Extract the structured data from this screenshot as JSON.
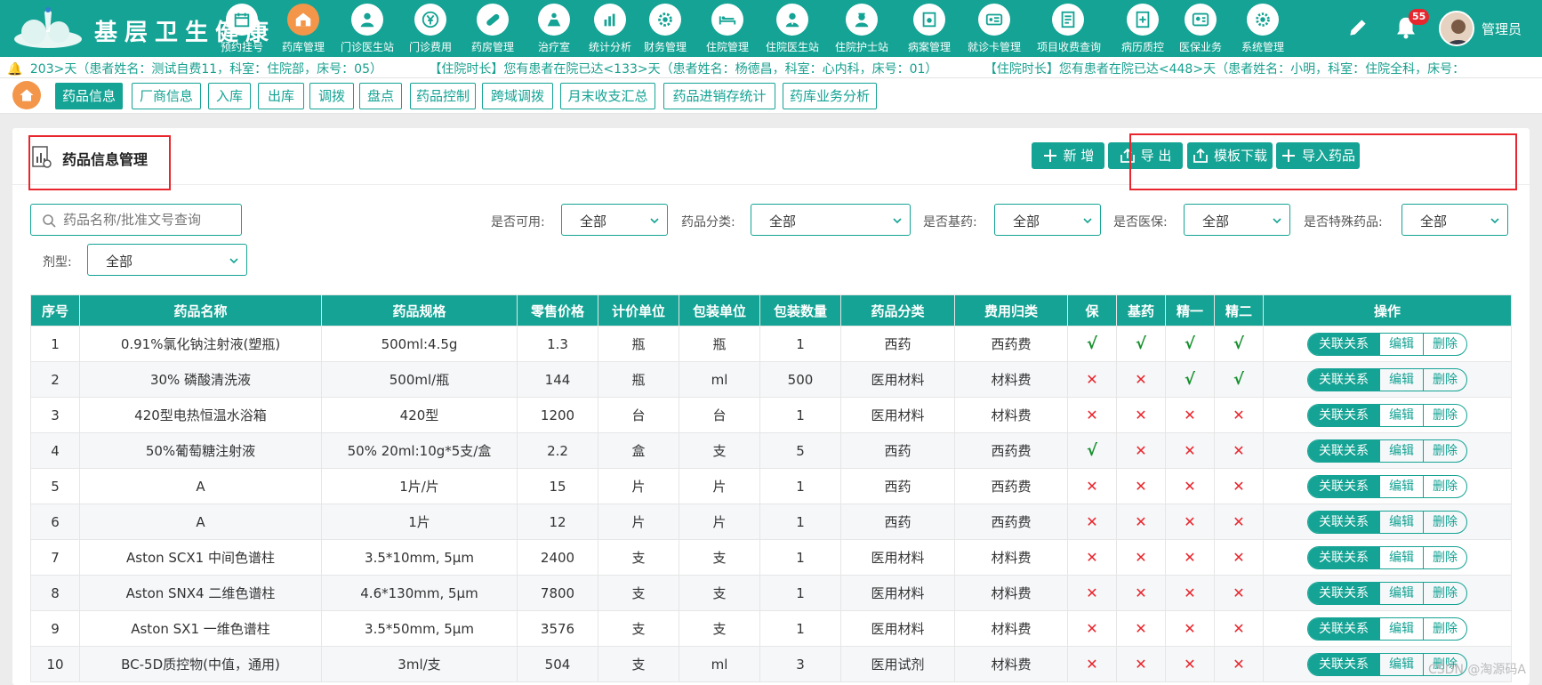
{
  "app": {
    "title": "基层卫生健康",
    "notification_count": "55",
    "user": "管理员"
  },
  "nav": [
    {
      "label": "预约挂号",
      "icon": "calendar-icon"
    },
    {
      "label": "药库管理",
      "icon": "warehouse-icon"
    },
    {
      "label": "门诊医生站",
      "icon": "doctor-icon"
    },
    {
      "label": "门诊费用",
      "icon": "yen-icon"
    },
    {
      "label": "药房管理",
      "icon": "pill-icon"
    },
    {
      "label": "治疗室",
      "icon": "therapy-icon"
    },
    {
      "label": "统计分析",
      "icon": "chart-icon"
    },
    {
      "label": "财务管理",
      "icon": "finance-gear-icon"
    },
    {
      "label": "住院管理",
      "icon": "hospital-bed-icon"
    },
    {
      "label": "住院医生站",
      "icon": "inpatient-doctor-icon"
    },
    {
      "label": "住院护士站",
      "icon": "nurse-station-icon"
    },
    {
      "label": "病案管理",
      "icon": "record-box-icon"
    },
    {
      "label": "就诊卡管理",
      "icon": "id-card-icon"
    },
    {
      "label": "项目收费查询",
      "icon": "fee-query-icon"
    },
    {
      "label": "病历质控",
      "icon": "medical-record-icon"
    },
    {
      "label": "医保业务",
      "icon": "insurance-icon"
    },
    {
      "label": "系统管理",
      "icon": "settings-icon"
    }
  ],
  "marquee": [
    "203>天（患者姓名：测试自费11，科室：住院部，床号：05）",
    "【住院时长】您有患者在院已达<133>天（患者姓名：杨德昌，科室：心内科，床号：01）",
    "【住院时长】您有患者在院已达<448>天（患者姓名：小明，科室：住院全科，床号："
  ],
  "tabs": [
    "药品信息",
    "厂商信息",
    "入库",
    "出库",
    "调拨",
    "盘点",
    "药品控制",
    "跨域调拨",
    "月末收支汇总",
    "药品进销存统计",
    "药库业务分析"
  ],
  "page": {
    "title": "药品信息管理",
    "buttons": {
      "add": "新 增",
      "export": "导 出",
      "template": "模板下载",
      "import": "导入药品"
    }
  },
  "filters": {
    "search_placeholder": "药品名称/批准文号查询",
    "available_label": "是否可用:",
    "available_value": "全部",
    "category_label": "药品分类:",
    "category_value": "全部",
    "basic_label": "是否基药:",
    "basic_value": "全部",
    "insurance_label": "是否医保:",
    "insurance_value": "全部",
    "special_label": "是否特殊药品:",
    "special_value": "全部",
    "dosage_label": "剂型:",
    "dosage_value": "全部"
  },
  "table": {
    "columns": [
      "序号",
      "药品名称",
      "药品规格",
      "零售价格",
      "计价单位",
      "包装单位",
      "包装数量",
      "药品分类",
      "费用归类",
      "保",
      "基药",
      "精一",
      "精二",
      "操作"
    ],
    "ops": [
      "关联关系",
      "编辑",
      "删除"
    ],
    "rows": [
      {
        "no": "1",
        "name": "0.91%氯化钠注射液(塑瓶)",
        "spec": "500ml:4.5g",
        "price": "1.3",
        "unit": "瓶",
        "pack_unit": "瓶",
        "pack_qty": "1",
        "category": "西药",
        "fee": "西药费",
        "flags": [
          true,
          true,
          true,
          true
        ]
      },
      {
        "no": "2",
        "name": "30% 磷酸清洗液",
        "spec": "500ml/瓶",
        "price": "144",
        "unit": "瓶",
        "pack_unit": "ml",
        "pack_qty": "500",
        "category": "医用材料",
        "fee": "材料费",
        "flags": [
          false,
          false,
          true,
          true
        ]
      },
      {
        "no": "3",
        "name": "420型电热恒温水浴箱",
        "spec": "420型",
        "price": "1200",
        "unit": "台",
        "pack_unit": "台",
        "pack_qty": "1",
        "category": "医用材料",
        "fee": "材料费",
        "flags": [
          false,
          false,
          false,
          false
        ]
      },
      {
        "no": "4",
        "name": "50%葡萄糖注射液",
        "spec": "50% 20ml:10g*5支/盒",
        "price": "2.2",
        "unit": "盒",
        "pack_unit": "支",
        "pack_qty": "5",
        "category": "西药",
        "fee": "西药费",
        "flags": [
          true,
          false,
          false,
          false
        ]
      },
      {
        "no": "5",
        "name": "A",
        "spec": "1片/片",
        "price": "15",
        "unit": "片",
        "pack_unit": "片",
        "pack_qty": "1",
        "category": "西药",
        "fee": "西药费",
        "flags": [
          false,
          false,
          false,
          false
        ]
      },
      {
        "no": "6",
        "name": "A",
        "spec": "1片",
        "price": "12",
        "unit": "片",
        "pack_unit": "片",
        "pack_qty": "1",
        "category": "西药",
        "fee": "西药费",
        "flags": [
          false,
          false,
          false,
          false
        ]
      },
      {
        "no": "7",
        "name": "Aston SCX1 中间色谱柱",
        "spec": "3.5*10mm, 5μm",
        "price": "2400",
        "unit": "支",
        "pack_unit": "支",
        "pack_qty": "1",
        "category": "医用材料",
        "fee": "材料费",
        "flags": [
          false,
          false,
          false,
          false
        ]
      },
      {
        "no": "8",
        "name": "Aston SNX4 二维色谱柱",
        "spec": "4.6*130mm, 5μm",
        "price": "7800",
        "unit": "支",
        "pack_unit": "支",
        "pack_qty": "1",
        "category": "医用材料",
        "fee": "材料费",
        "flags": [
          false,
          false,
          false,
          false
        ]
      },
      {
        "no": "9",
        "name": "Aston SX1 一维色谱柱",
        "spec": "3.5*50mm, 5μm",
        "price": "3576",
        "unit": "支",
        "pack_unit": "支",
        "pack_qty": "1",
        "category": "医用材料",
        "fee": "材料费",
        "flags": [
          false,
          false,
          false,
          false
        ]
      },
      {
        "no": "10",
        "name": "BC-5D质控物(中值，通用)",
        "spec": "3ml/支",
        "price": "504",
        "unit": "支",
        "pack_unit": "ml",
        "pack_qty": "3",
        "category": "医用试剂",
        "fee": "材料费",
        "flags": [
          false,
          false,
          false,
          false
        ]
      }
    ]
  },
  "watermark": "CSDN @淘源码A",
  "colors": {
    "primary": "#14a394",
    "accent": "#f3964a",
    "danger": "#e8262d",
    "ok": "#15902c"
  }
}
